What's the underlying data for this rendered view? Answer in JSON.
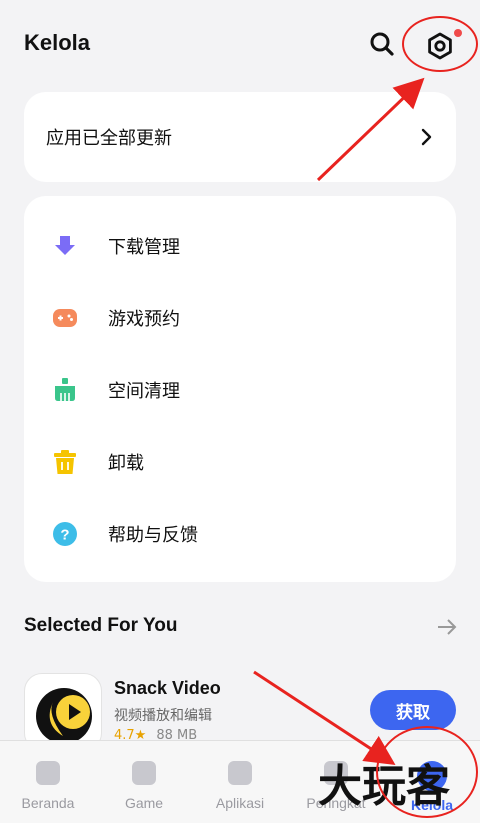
{
  "header": {
    "title": "Kelola",
    "search_icon": "search-icon",
    "settings_icon": "settings-icon"
  },
  "update_card": {
    "text": "应用已全部更新"
  },
  "menu": [
    {
      "label": "下载管理",
      "icon": "download-icon",
      "color": "#7b6cf6"
    },
    {
      "label": "游戏预约",
      "icon": "gamepad-icon",
      "color": "#f58a5c"
    },
    {
      "label": "空间清理",
      "icon": "cleanup-icon",
      "color": "#3ac58b"
    },
    {
      "label": "卸载",
      "icon": "trash-icon",
      "color": "#f5c400"
    },
    {
      "label": "帮助与反馈",
      "icon": "help-icon",
      "color": "#3dbde8"
    }
  ],
  "section": {
    "title": "Selected For You"
  },
  "app": {
    "name": "Snack Video",
    "description": "视频播放和编辑",
    "rating": "4.7★",
    "size": "88 MB",
    "get_label": "获取"
  },
  "bottom_nav": [
    {
      "label": "Beranda",
      "active": false
    },
    {
      "label": "Game",
      "active": false
    },
    {
      "label": "Aplikasi",
      "active": false
    },
    {
      "label": "Peringkat",
      "active": false
    },
    {
      "label": "Kelola",
      "active": true
    }
  ],
  "watermark": "大玩客",
  "colors": {
    "accent": "#3d66f0",
    "annotation": "#e8231f"
  }
}
